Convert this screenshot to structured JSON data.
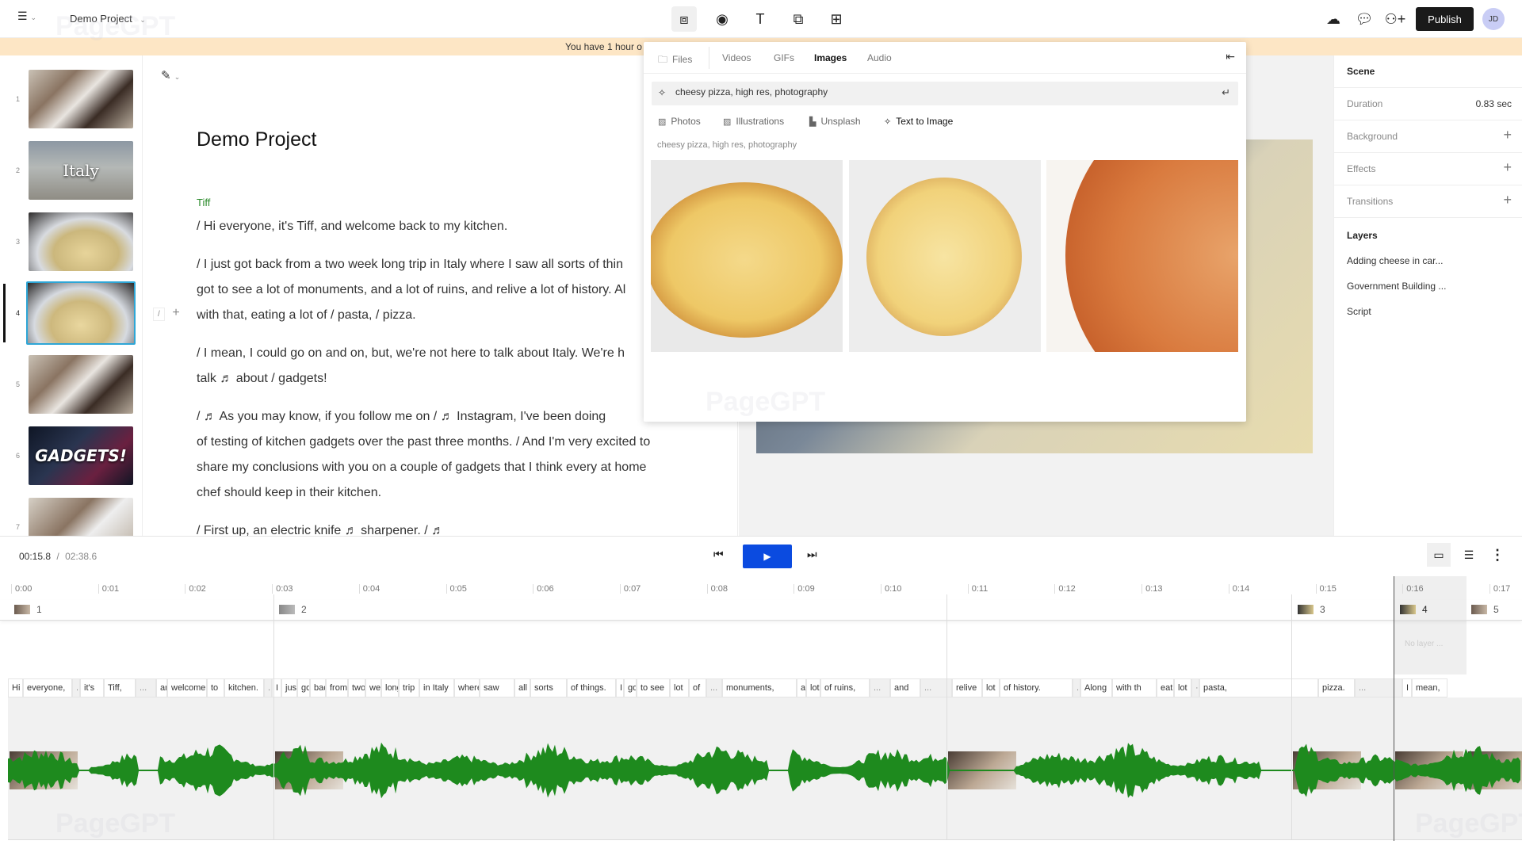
{
  "app": {
    "project_name": "Demo Project",
    "watermark": "PageGPT"
  },
  "topbar": {
    "tools": [
      {
        "name": "media-library",
        "glyph": "▣"
      },
      {
        "name": "record",
        "glyph": "◉"
      },
      {
        "name": "text",
        "glyph": "T"
      },
      {
        "name": "shapes",
        "glyph": "⧉"
      },
      {
        "name": "templates",
        "glyph": "▦"
      }
    ],
    "publish_label": "Publish",
    "avatar_initials": "JD",
    "accent": "#1a1a1a"
  },
  "banner": {
    "text": "You have 1 hour o"
  },
  "scenes": [
    {
      "number": "1",
      "label": "",
      "kind": "person"
    },
    {
      "number": "2",
      "label": "Italy",
      "kind": "building"
    },
    {
      "number": "3",
      "label": "",
      "kind": "pasta"
    },
    {
      "number": "4",
      "label": "",
      "kind": "pasta",
      "active": true
    },
    {
      "number": "5",
      "label": "",
      "kind": "person"
    },
    {
      "number": "6",
      "label": "GADGETS!",
      "kind": "gadgets"
    },
    {
      "number": "7",
      "label": "",
      "kind": "person"
    }
  ],
  "editor": {
    "title": "Demo Project",
    "speaker": "Tiff",
    "paragraphs": [
      [
        "/ Hi everyone, it's Tiff, and welcome back to my kitchen."
      ],
      [
        "/ I just got back from a two week long trip in Italy where I saw all sorts of thin",
        "got to see a lot of monuments, and a lot of ruins, and relive a lot of history. Al",
        "with that, eating a lot of / pasta, / pizza."
      ],
      [
        "/ I mean, I could go on and on, but, we're not here to talk about Italy. We're h",
        "talk ♬ about / gadgets!"
      ],
      [
        " / ♬ As you may know, if you follow me on / ♬ Instagram, I've been doing",
        "of testing of kitchen gadgets over the past three months. / And I'm very excited to",
        "share my conclusions with you on a couple of gadgets that I think every at home",
        "chef should keep in their kitchen."
      ],
      [
        " / First up, an electric knife ♬ sharpener. / ♬"
      ]
    ]
  },
  "media_panel": {
    "tabs": [
      {
        "label": "Files",
        "active": false
      },
      {
        "label": "Videos",
        "active": false
      },
      {
        "label": "GIFs",
        "active": false
      },
      {
        "label": "Images",
        "active": true
      },
      {
        "label": "Audio",
        "active": false
      }
    ],
    "search_value": "cheesy pizza, high res, photography",
    "sources": [
      {
        "label": "Photos",
        "active": false
      },
      {
        "label": "Illustrations",
        "active": false
      },
      {
        "label": "Unsplash",
        "active": false
      },
      {
        "label": "Text to Image",
        "active": true
      }
    ],
    "results_caption": "cheesy pizza, high res, photography",
    "results": [
      {
        "alt": "cheesy pizza 1"
      },
      {
        "alt": "cheesy pizza 2"
      },
      {
        "alt": "cheesy pizza 3"
      }
    ]
  },
  "properties": {
    "scene_heading": "Scene",
    "rows": [
      {
        "label": "Duration",
        "value": "0.83 sec"
      },
      {
        "label": "Background",
        "value": "+"
      },
      {
        "label": "Effects",
        "value": "+"
      },
      {
        "label": "Transitions",
        "value": "+"
      }
    ],
    "layers_heading": "Layers",
    "layers": [
      "Adding cheese in car...",
      "Government Building ...",
      "Script"
    ]
  },
  "timeline": {
    "current_time": "00:15.8",
    "separator": "/",
    "total_time": "02:38.6",
    "ruler": [
      "0:00",
      "0:01",
      "0:02",
      "0:03",
      "0:04",
      "0:05",
      "0:06",
      "0:07",
      "0:08",
      "0:09",
      "0:10",
      "0:11",
      "0:12",
      "0:13",
      "0:14",
      "0:15",
      "0:16",
      "0:17"
    ],
    "scene_markers": [
      "1",
      "2",
      "3",
      "4",
      "5"
    ],
    "no_layer_text": "No layer ...",
    "words": [
      "Hi",
      "everyone,",
      ".",
      "it's",
      "Tiff,",
      "...",
      "ar",
      "welcome",
      "to",
      "kitchen.",
      ".",
      "I",
      "just",
      "go",
      "back",
      "from",
      "two",
      "week",
      "long",
      "trip",
      "in Italy",
      "where",
      "saw",
      "all",
      "sorts",
      "of things.",
      "I",
      "got",
      "to see",
      "lot",
      "of",
      "...",
      "monuments,",
      "ar",
      "lot",
      "of ruins,",
      "...",
      "and",
      "...",
      "relive",
      "lot",
      "of history.",
      ".",
      "Along",
      "with th",
      "eati",
      "lot",
      "·",
      "pasta,",
      "pizza.",
      "...",
      "I",
      "mean,"
    ],
    "waveform_color": "#1e8a1e",
    "play_color": "#0b4be0"
  }
}
